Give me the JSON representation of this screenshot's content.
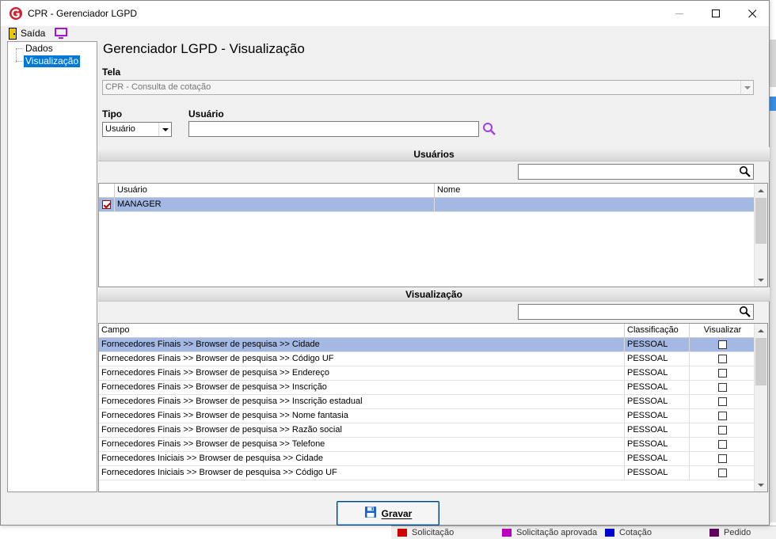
{
  "window": {
    "title": "CPR - Gerenciador LGPD"
  },
  "toolbar": {
    "exit_label": "Saída"
  },
  "tree": {
    "items": [
      {
        "label": "Dados"
      },
      {
        "label": "Visualização",
        "selected": true
      }
    ]
  },
  "page": {
    "title": "Gerenciador LGPD - Visualização"
  },
  "form": {
    "tela_label": "Tela",
    "tela_value": "CPR - Consulta de cotação",
    "tipo_label": "Tipo",
    "tipo_value": "Usuário",
    "usuario_label": "Usuário",
    "usuario_value": ""
  },
  "users_section": {
    "header": "Usuários",
    "filter_value": "",
    "columns": [
      "Usuário",
      "Nome"
    ],
    "rows": [
      {
        "checked": true,
        "usuario": "MANAGER",
        "nome": ""
      }
    ]
  },
  "view_section": {
    "header": "Visualização",
    "filter_value": "",
    "columns": [
      "Campo",
      "Classificação",
      "Visualizar"
    ],
    "rows": [
      {
        "campo": "Fornecedores Finais >> Browser de pesquisa >> Cidade",
        "classificacao": "PESSOAL",
        "visualizar": false
      },
      {
        "campo": "Fornecedores Finais >> Browser de pesquisa >> Código UF",
        "classificacao": "PESSOAL",
        "visualizar": false
      },
      {
        "campo": "Fornecedores Finais >> Browser de pesquisa >> Endereço",
        "classificacao": "PESSOAL",
        "visualizar": false
      },
      {
        "campo": "Fornecedores Finais >> Browser de pesquisa >> Inscrição",
        "classificacao": "PESSOAL",
        "visualizar": false
      },
      {
        "campo": "Fornecedores Finais >> Browser de pesquisa >> Inscrição estadual",
        "classificacao": "PESSOAL",
        "visualizar": false
      },
      {
        "campo": "Fornecedores Finais >> Browser de pesquisa >> Nome fantasia",
        "classificacao": "PESSOAL",
        "visualizar": false
      },
      {
        "campo": "Fornecedores Finais >> Browser de pesquisa >> Razão social",
        "classificacao": "PESSOAL",
        "visualizar": false
      },
      {
        "campo": "Fornecedores Finais >> Browser de pesquisa >> Telefone",
        "classificacao": "PESSOAL",
        "visualizar": false
      },
      {
        "campo": "Fornecedores Iniciais >> Browser de pesquisa >> Cidade",
        "classificacao": "PESSOAL",
        "visualizar": false
      },
      {
        "campo": "Fornecedores Iniciais >> Browser de pesquisa >> Código UF",
        "classificacao": "PESSOAL",
        "visualizar": false
      }
    ]
  },
  "actions": {
    "save_label": "Gravar"
  },
  "background": {
    "legend": [
      {
        "label": "Solicitação",
        "color": "#d00000"
      },
      {
        "label": "Solicitação aprovada",
        "color": "#c000c0"
      },
      {
        "label": "Cotação",
        "color": "#0000d0"
      },
      {
        "label": "Pedido",
        "color": "#600060"
      }
    ]
  },
  "colors": {
    "selection": "#a3b9e3",
    "tree_selection": "#0078d7",
    "logo": "#d02030",
    "search_icon": "#a040e0"
  }
}
